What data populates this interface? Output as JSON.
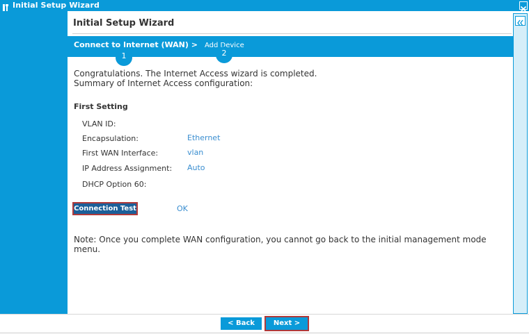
{
  "window": {
    "title": "Initial Setup Wizard",
    "icon": "wrench-screwdriver-icon",
    "close_icon": "close-icon"
  },
  "header": {
    "title": "Initial Setup Wizard"
  },
  "steps": [
    {
      "label": "Connect to Internet (WAN) >",
      "number": "1",
      "active": true
    },
    {
      "label": "Add Device",
      "number": "2",
      "active": false
    }
  ],
  "messages": {
    "congrats": "Congratulations. The Internet Access wizard is completed.",
    "summary": "Summary of Internet Access configuration:"
  },
  "section": {
    "title": "First Setting",
    "fields": [
      {
        "label": "VLAN ID:",
        "value": ""
      },
      {
        "label": "Encapsulation:",
        "value": "Ethernet"
      },
      {
        "label": "First WAN Interface:",
        "value": "vlan"
      },
      {
        "label": "IP Address Assignment:",
        "value": "Auto"
      },
      {
        "label": "DHCP Option 60:",
        "value": ""
      }
    ]
  },
  "connection_test": {
    "button_label": "Connection Test",
    "result": "OK"
  },
  "note": "Note: Once you complete WAN configuration, you cannot go back to the initial management mode menu.",
  "footer": {
    "back_label": "< Back",
    "next_label": "Next >"
  },
  "sidebar": {
    "collapse_icon": "double-chevron-left-icon"
  },
  "colors": {
    "accent": "#0a9ad9",
    "button_dark": "#1b5f99",
    "highlight_border": "#b03a3a",
    "value_text": "#3a8ed0"
  }
}
